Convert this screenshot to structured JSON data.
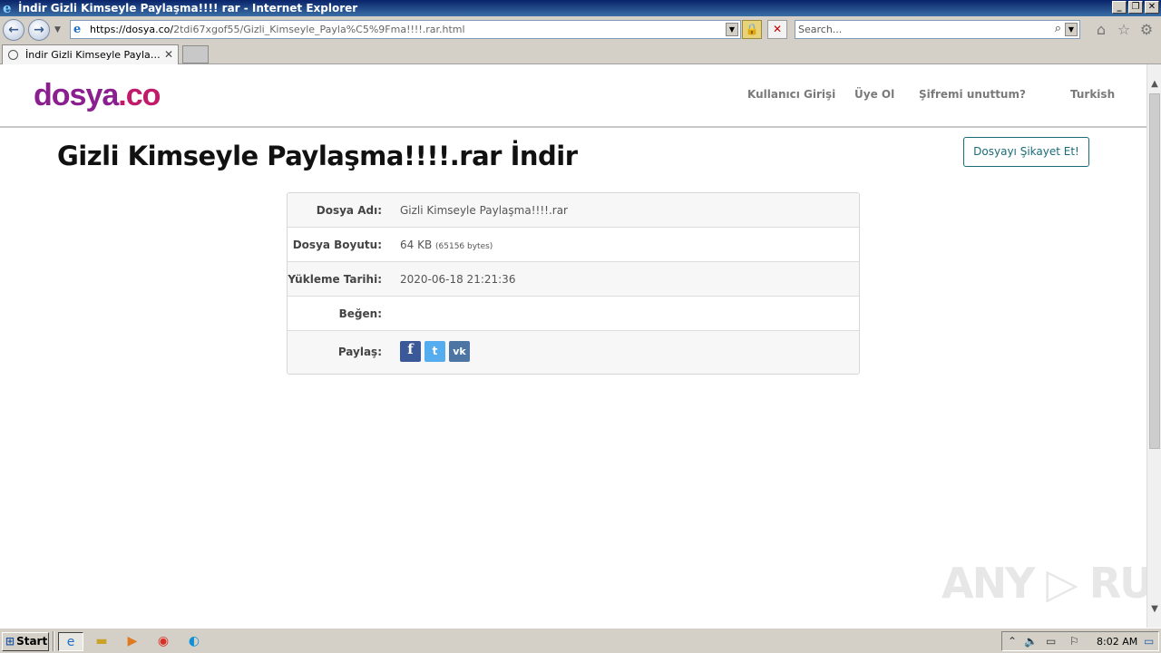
{
  "window": {
    "title": "İndir Gizli Kimseyle Paylaşma!!!! rar - Internet Explorer",
    "controls": {
      "minimize": "_",
      "restore": "❐",
      "close": "✕"
    }
  },
  "navigation": {
    "url_host": "https://dosya.co/",
    "url_rest": "2tdi67xgof55/Gizli_Kimseyle_Payla%C5%9Fma!!!!.rar.html",
    "search_placeholder": "Search..."
  },
  "tabs": [
    {
      "label": "İndir Gizli Kimseyle Paylaşma!...",
      "active": true
    }
  ],
  "site": {
    "logo_part1": "dosya",
    "logo_part2": ".co",
    "nav": {
      "login": "Kullanıcı Girişi",
      "register": "Üye Ol",
      "forgot": "Şifremi unuttum?",
      "language": "Turkish"
    }
  },
  "page": {
    "title": "Gizli Kimseyle Paylaşma!!!!.rar İndir",
    "report_button": "Dosyayı Şikayet Et!",
    "file_info": {
      "name_label": "Dosya Adı:",
      "name_value": "Gizli Kimseyle Paylaşma!!!!.rar",
      "size_label": "Dosya Boyutu:",
      "size_value": "64 KB",
      "size_bytes": "(65156 bytes)",
      "date_label": "Yükleme Tarihi:",
      "date_value": "2020-06-18 21:21:36",
      "like_label": "Beğen:",
      "share_label": "Paylaş:"
    },
    "share": [
      {
        "network": "facebook",
        "icon": "f",
        "color": "#3b5998"
      },
      {
        "network": "twitter",
        "icon": "t",
        "color": "#55acee"
      },
      {
        "network": "vk",
        "icon": "vk",
        "color": "#4c75a3"
      }
    ]
  },
  "watermark": "ANY ▷ RUN",
  "taskbar": {
    "start_label": "Start",
    "clock": "8:02 AM"
  }
}
